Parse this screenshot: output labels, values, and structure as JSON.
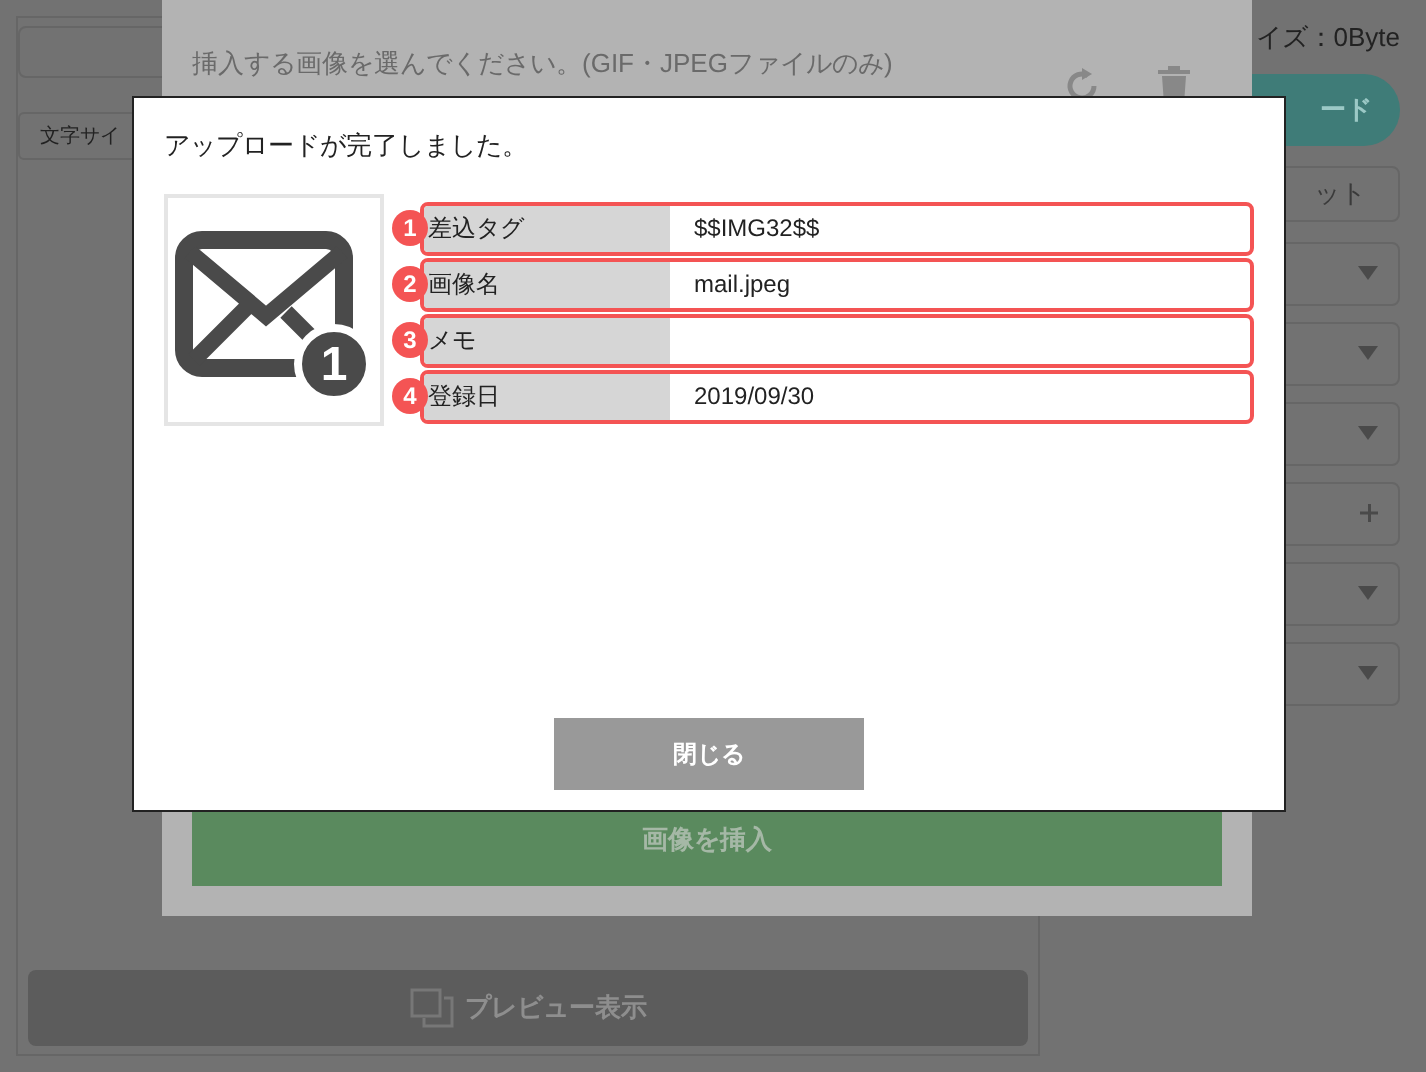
{
  "editor": {
    "size_label": "イズ：0Byte",
    "font_size_select": "文字サイ",
    "upload_button": "ード",
    "reset_button": "ット",
    "side_controls": [
      {
        "kind": "select"
      },
      {
        "kind": "select"
      },
      {
        "kind": "select"
      },
      {
        "kind": "add"
      },
      {
        "kind": "select"
      },
      {
        "kind": "select"
      }
    ],
    "preview_button": "プレビュー表示"
  },
  "image_dialog": {
    "instruction": "挿入する画像を選んでください。(GIF・JPEGファイルのみ)",
    "insert_button": "画像を挿入"
  },
  "upload_modal": {
    "message": "アップロードが完了しました。",
    "image_badge": "1",
    "fields": [
      {
        "number": "1",
        "label": "差込タグ",
        "value": "$$IMG32$$"
      },
      {
        "number": "2",
        "label": "画像名",
        "value": "mail.jpeg"
      },
      {
        "number": "3",
        "label": "メモ"
      },
      {
        "number": "4",
        "label": "登録日",
        "value": "2019/09/30"
      }
    ],
    "close_button": "閉じる"
  }
}
